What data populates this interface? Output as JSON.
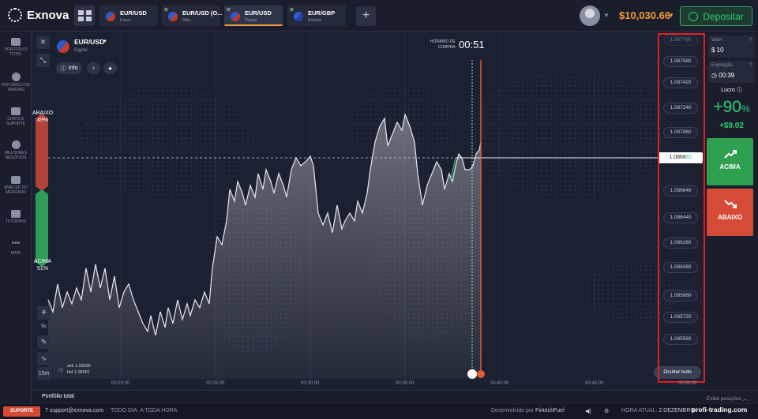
{
  "app": {
    "brand": "Exnova"
  },
  "tabs": [
    {
      "asset": "EUR/USD",
      "type": "Forex"
    },
    {
      "asset": "EUR/USD (O...",
      "type": "Blitz"
    },
    {
      "asset": "EUR/USD",
      "type": "Digital"
    },
    {
      "asset": "EUR/GBP",
      "type": "Binária"
    }
  ],
  "header": {
    "balance": "$10,030.66",
    "deposit_label": "Depositar"
  },
  "sidebar": {
    "items": [
      {
        "label_1": "PORTFÓLIO",
        "label_2": "TOTAL"
      },
      {
        "label_1": "HISTÓRICO DE",
        "label_2": "TRADING"
      },
      {
        "label_1": "CHATS E",
        "label_2": "SUPORTE"
      },
      {
        "label_1": "MELHORES",
        "label_2": "NEGÓCIOS"
      },
      {
        "label_1": "ANÁLISE DO",
        "label_2": "MERCADO"
      },
      {
        "label_1": "TUTORIAIS",
        "label_2": ""
      },
      {
        "label_1": "MAIS",
        "label_2": ""
      }
    ]
  },
  "asset": {
    "name": "EUR/USD",
    "type": "Digital",
    "info_label": "Info"
  },
  "purchase": {
    "label_1": "HORÁRIO DE",
    "label_2": "COMPRA",
    "timer": "00:51"
  },
  "sentiment": {
    "down_label": "ABAIXO",
    "down_pct": "49%",
    "up_label": "ACIMA",
    "up_pct": "51%"
  },
  "timeframe": {
    "candle": "5s",
    "period": "15m"
  },
  "ask_bid": {
    "ask": "ask 1.08695",
    "bid": "bid 1.08681"
  },
  "price_axis": {
    "ticks": [
      "1.087760",
      "1.087580",
      "1.087420",
      "1.087240",
      "1.087060",
      "1.086640",
      "1.086440",
      "1.086260",
      "1.086080",
      "1.085880",
      "1.085720",
      "1.085560"
    ],
    "current_prefix": "1.0868",
    "current_suffix": "82",
    "hide_all": "Ocultar tudo"
  },
  "x_axis": {
    "ticks": [
      "00:20:00",
      "00:25:00",
      "00:30:00",
      "00:35:00",
      "00:40:00",
      "00:45:00",
      "00:50:00"
    ]
  },
  "trade": {
    "value_label": "Valor",
    "value": "10",
    "expiration_label": "Expiração",
    "expiration": "00:39",
    "profit_label": "Lucro",
    "profit_pct_main": "+90",
    "profit_pct_sign": "%",
    "profit_amount": "+$9.02",
    "up_label": "ACIMA",
    "down_label": "ABAIXO"
  },
  "portfolio": {
    "title": "Portfólio total",
    "toggle": "Exibir posições"
  },
  "status": {
    "support": "SUPORTE",
    "email": "support@exnova.com",
    "hours": "TODO DIA, A TODA HORA",
    "developed_by": "Desenvolvido por",
    "developer": "FintechFuel",
    "time_label": "HORA ATUAL:",
    "time_value": "2 DEZEMBRO"
  },
  "watermark": "profi-trading.com",
  "colors": {
    "up": "#2ecc71",
    "down": "#d64b36",
    "accent": "#f39c37",
    "highlight": "#e02020"
  }
}
